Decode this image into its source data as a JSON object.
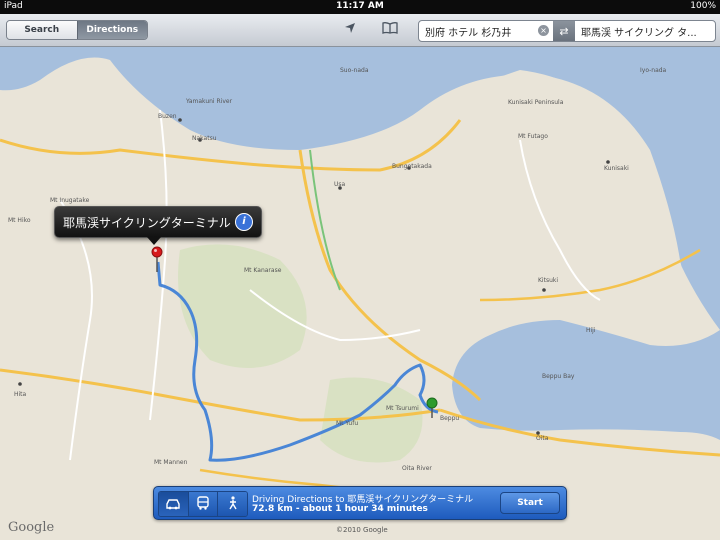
{
  "status": {
    "device": "iPad",
    "time": "11:17 AM",
    "battery": "100%"
  },
  "toolbar": {
    "search_tab": "Search",
    "directions_tab": "Directions",
    "route_from": "別府 ホテル 杉乃井",
    "route_to": "耶馬渓 サイクリング タ..."
  },
  "callout": {
    "title": "耶馬渓サイクリングターミナル"
  },
  "directions": {
    "line1": "Driving Directions to 耶馬渓サイクリングターミナル",
    "line2": "72.8 km - about 1 hour 34 minutes",
    "start_label": "Start"
  },
  "map": {
    "google_logo": "Google",
    "copyright": "©2010 Google",
    "labels": {
      "mt_futago": "Mt Futago",
      "kunisaki_peninsula": "Kunisaki Peninsula",
      "kunisaki": "Kunisaki",
      "bungotakada": "Bungotakada",
      "usa": "Usa",
      "buzen": "Buzen",
      "nakatsu": "Nakatsu",
      "yamakuni_river": "Yamakuni River",
      "mt_inugatake": "Mt Inugatake",
      "mt_kanarase": "Mt Kanarase",
      "kitsuki": "Kitsuki",
      "hiji": "Hiji",
      "beppu_bay": "Beppu Bay",
      "mt_tsurumi": "Mt Tsurumi",
      "mt_yufu": "Mt Yufu",
      "mt_hiko": "Mt Hiko",
      "hita": "Hita",
      "mt_mannen": "Mt Mannen",
      "oita_river": "Oita River",
      "oita": "Oita",
      "beppu": "Beppu",
      "sea_label": "Suo-nada",
      "iyo_nada": "Iyo-nada"
    }
  },
  "colors": {
    "sea": "#a6bfdd",
    "land": "#e9e4d8",
    "route": "#4a86d6",
    "highway": "#f4c24c",
    "pin_start": "#2d9b2d",
    "pin_end": "#d7191c"
  }
}
